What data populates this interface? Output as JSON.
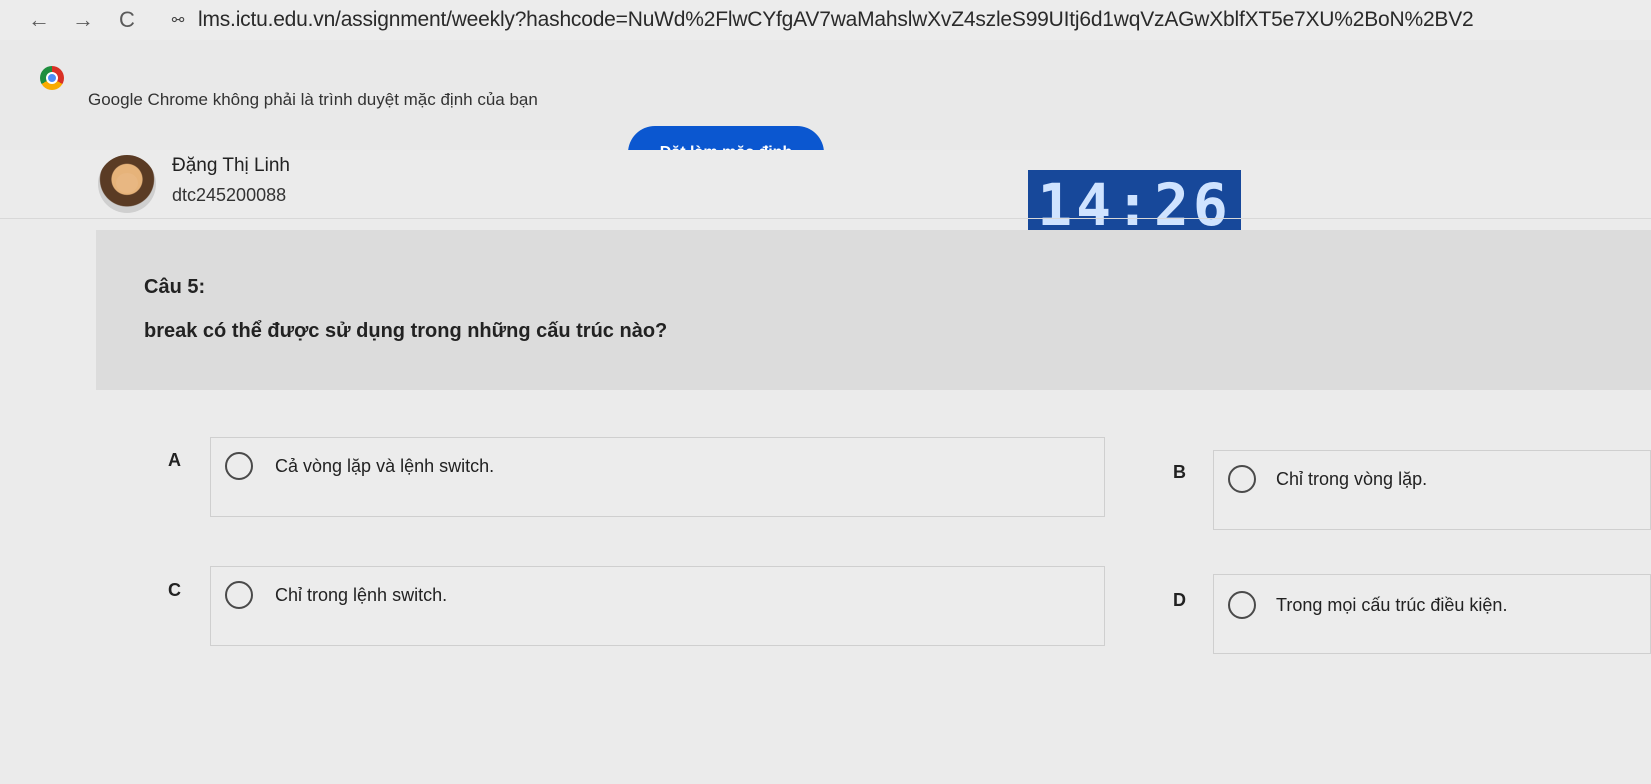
{
  "browser": {
    "back_icon": "←",
    "forward_icon": "→",
    "reload_icon": "C",
    "site_info_icon": "⚯",
    "url": "lms.ictu.edu.vn/assignment/weekly?hashcode=NuWd%2FlwCYfgAV7waMahslwXvZ4szleS99UItj6d1wqVzAGwXblfXT5e7XU%2BoN%2BV2"
  },
  "infobar": {
    "message": "Google Chrome không phải là trình duyệt mặc định của bạn",
    "button_label": "Đặt làm mặc định"
  },
  "user": {
    "name": "Đặng Thị Linh",
    "id": "dtc245200088"
  },
  "timer": {
    "display": "14:26"
  },
  "question": {
    "number_label": "Câu 5:",
    "text": "break có thể được sử dụng trong những cấu trúc nào?"
  },
  "answers": [
    {
      "letter": "A",
      "text": "Cả vòng lặp và lệnh switch."
    },
    {
      "letter": "B",
      "text": "Chỉ trong vòng lặp."
    },
    {
      "letter": "C",
      "text": "Chỉ trong lệnh switch."
    },
    {
      "letter": "D",
      "text": "Trong mọi cấu trúc điều kiện."
    }
  ]
}
